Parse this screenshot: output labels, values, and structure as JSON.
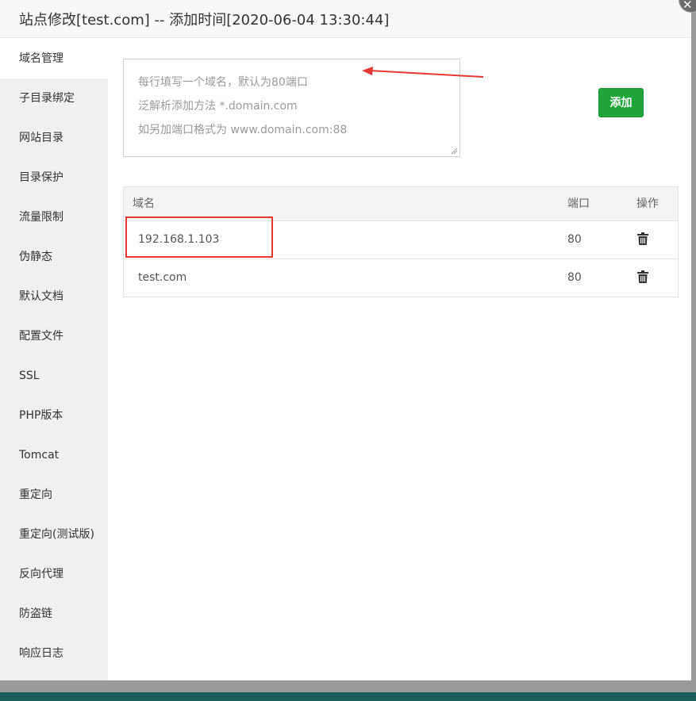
{
  "dialog": {
    "title": "站点修改[test.com] -- 添加时间[2020-06-04 13:30:44]"
  },
  "sidebar": {
    "items": [
      {
        "label": "域名管理",
        "active": true
      },
      {
        "label": "子目录绑定"
      },
      {
        "label": "网站目录"
      },
      {
        "label": "目录保护"
      },
      {
        "label": "流量限制"
      },
      {
        "label": "伪静态"
      },
      {
        "label": "默认文档"
      },
      {
        "label": "配置文件"
      },
      {
        "label": "SSL"
      },
      {
        "label": "PHP版本"
      },
      {
        "label": "Tomcat"
      },
      {
        "label": "重定向"
      },
      {
        "label": "重定向(测试版)"
      },
      {
        "label": "反向代理"
      },
      {
        "label": "防盗链"
      },
      {
        "label": "响应日志"
      }
    ]
  },
  "domain_input": {
    "placeholder_lines": [
      "每行填写一个域名，默认为80端口",
      "泛解析添加方法 *.domain.com",
      "如另加端口格式为 www.domain.com:88"
    ]
  },
  "add_button": {
    "label": "添加",
    "color": "#20a53a"
  },
  "table": {
    "headers": {
      "domain": "域名",
      "port": "端口",
      "action": "操作"
    },
    "rows": [
      {
        "domain": "192.168.1.103",
        "port": "80"
      },
      {
        "domain": "test.com",
        "port": "80"
      }
    ]
  },
  "annotations": {
    "color": "#e53935"
  },
  "icons": {
    "close": "close-icon",
    "delete": "trash-icon"
  }
}
